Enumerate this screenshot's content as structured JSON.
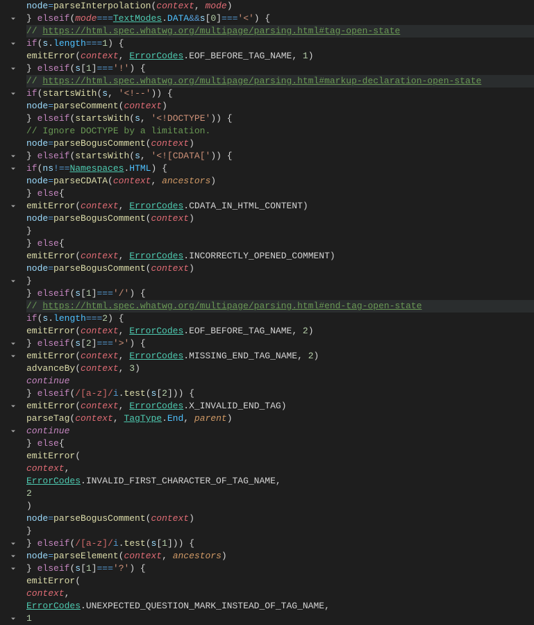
{
  "gutter": {
    "collapsibleLines": [
      2,
      4,
      6,
      8,
      13,
      14,
      17,
      23,
      28,
      29,
      33,
      35,
      44,
      45,
      46,
      50
    ]
  },
  "tokens": {
    "kw_else": "else",
    "kw_if": "if",
    "kw_continue": "continue",
    "op_eq3": "===",
    "op_neq3": "!==",
    "op_and": "&&",
    "op_assign": "=",
    "var_node": "node",
    "var_mode": "mode",
    "var_context": "context",
    "var_s": "s",
    "var_ns": "ns",
    "var_ancestors": "ancestors",
    "var_parent": "parent",
    "fn_parseInterpolation": "parseInterpolation",
    "fn_emitError": "emitError",
    "fn_startsWith": "startsWith",
    "fn_parseComment": "parseComment",
    "fn_parseBogusComment": "parseBogusComment",
    "fn_parseCDATA": "parseCDATA",
    "fn_advanceBy": "advanceBy",
    "fn_parseTag": "parseTag",
    "fn_parseElement": "parseElement",
    "fn_test": "test",
    "type_TextModes": "TextModes",
    "type_ErrorCodes": "ErrorCodes",
    "type_Namespaces": "Namespaces",
    "type_TagType": "TagType",
    "prop_DATA": "DATA",
    "prop_length": "length",
    "prop_HTML": "HTML",
    "prop_End": "End",
    "const_EOF_BEFORE_TAG_NAME": "EOF_BEFORE_TAG_NAME",
    "const_CDATA_IN_HTML_CONTENT": "CDATA_IN_HTML_CONTENT",
    "const_INCORRECTLY_OPENED_COMMENT": "INCORRECTLY_OPENED_COMMENT",
    "const_MISSING_END_TAG_NAME": "MISSING_END_TAG_NAME",
    "const_X_INVALID_END_TAG": "X_INVALID_END_TAG",
    "const_INVALID_FIRST_CHARACTER_OF_TAG_NAME": "INVALID_FIRST_CHARACTER_OF_TAG_NAME",
    "const_UNEXPECTED_QUESTION_MARK_INSTEAD_OF_TAG_NAME": "UNEXPECTED_QUESTION_MARK_INSTEAD_OF_TAG_NAME",
    "str_lt": "'<'",
    "str_bang": "'!'",
    "str_comment_open": "'<!--'",
    "str_doctype": "'<!DOCTYPE'",
    "str_cdata_open": "'<![CDATA['",
    "str_slash": "'/'",
    "str_gt": "'>'",
    "str_qmark": "'?'",
    "num_0": "0",
    "num_1": "1",
    "num_2": "2",
    "num_3": "3",
    "regex_az": "[a-z]",
    "regex_flag_i": "i",
    "comment_tag_open": "// ",
    "link_tag_open": "https://html.spec.whatwg.org/multipage/parsing.html#tag-open-state",
    "link_markup_decl": "https://html.spec.whatwg.org/multipage/parsing.html#markup-declaration-open-state",
    "link_end_tag": "https://html.spec.whatwg.org/multipage/parsing.html#end-tag-open-state",
    "comment_ignore_doctype": "// Ignore DOCTYPE by a limitation."
  }
}
